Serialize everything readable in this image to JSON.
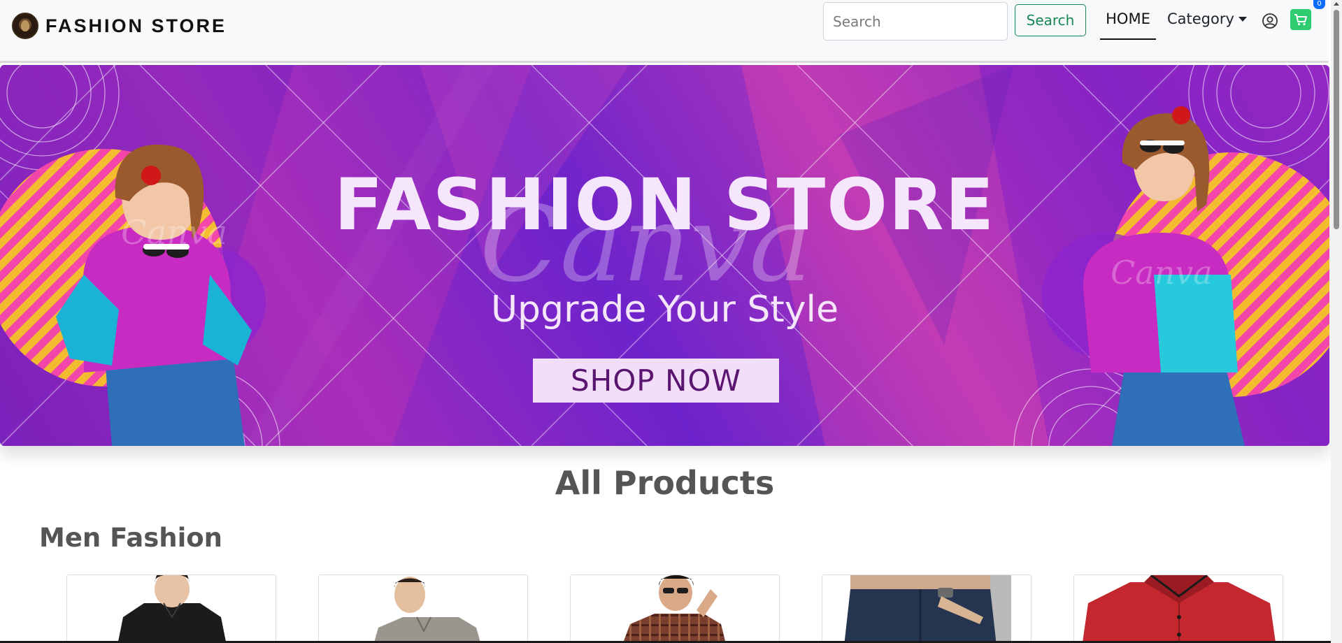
{
  "navbar": {
    "brand": "FASHION STORE",
    "search": {
      "placeholder": "Search",
      "value": ""
    },
    "search_button": "Search",
    "home_link": "HOME",
    "category_link": "Category",
    "cart_count": "0",
    "icons": [
      "brand-logo",
      "user-circle-icon",
      "cart-icon",
      "caret-down-icon"
    ]
  },
  "hero": {
    "title": "FASHION STORE",
    "subtitle": "Upgrade Your Style",
    "cta": "SHOP  NOW",
    "watermark": "Canva",
    "colors": {
      "bg_primary": "#8224c4",
      "bg_secondary": "#c23cb4",
      "text": "#f6e6fb",
      "button_bg": "#f3defa",
      "button_text": "#5a1570"
    }
  },
  "main": {
    "section_title": "All Products",
    "category_title": "Men Fashion",
    "products": [
      {
        "name": "black-shirt",
        "color": "#1b1b1b"
      },
      {
        "name": "grey-polo",
        "color": "#9a968f"
      },
      {
        "name": "plaid-shirt",
        "color": "#7a3f2f"
      },
      {
        "name": "jeans-beige-sweater",
        "color": "#25344f"
      },
      {
        "name": "red-shirt",
        "color": "#c4282e"
      }
    ]
  },
  "theme": {
    "accent_green": "#198754",
    "cart_green": "#2ecc71",
    "badge_blue": "#0d6efd"
  }
}
